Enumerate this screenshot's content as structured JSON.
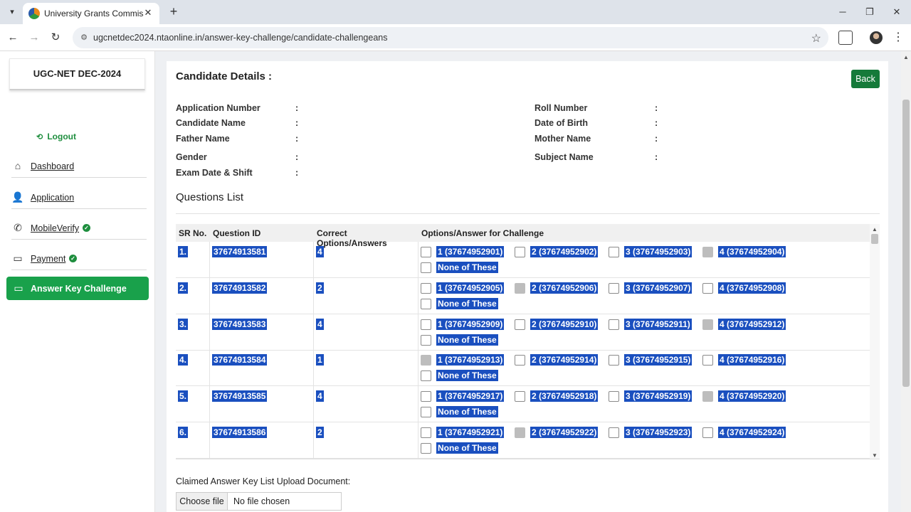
{
  "browser": {
    "tab_title": "University Grants Commission (",
    "url": "ugcnetdec2024.ntaonline.in/answer-key-challenge/candidate-challengeans"
  },
  "sidebar": {
    "brand": "UGC-NET DEC-2024",
    "logout": "Logout",
    "items": [
      {
        "label": "Dashboard",
        "icon": "home-icon",
        "verified": false
      },
      {
        "label": "Application",
        "icon": "person-add-icon",
        "verified": false
      },
      {
        "label": "MobileVerify",
        "icon": "phone-icon",
        "verified": true
      },
      {
        "label": "Payment",
        "icon": "card-icon",
        "verified": true
      }
    ],
    "active": {
      "label": "Answer Key Challenge",
      "icon": "card-icon"
    }
  },
  "candidate": {
    "title": "Candidate Details :",
    "back_label": "Back",
    "fields_left": [
      "Application Number",
      "Candidate Name",
      "Father Name",
      "Gender",
      "Exam Date & Shift"
    ],
    "fields_right": [
      "Roll Number",
      "Date of Birth",
      "Mother Name",
      "Subject Name"
    ],
    "colon": ":"
  },
  "questions": {
    "title": "Questions List",
    "headers": [
      "SR No.",
      "Question ID",
      "Correct Options/Answers",
      "Options/Answer for Challenge"
    ],
    "none_label": "None of These",
    "rows": [
      {
        "sr": "1.",
        "qid": "37674913581",
        "correct": "4",
        "options": [
          "1 (37674952901)",
          "2 (37674952902)",
          "3 (37674952903)",
          "4 (37674952904)"
        ]
      },
      {
        "sr": "2.",
        "qid": "37674913582",
        "correct": "2",
        "options": [
          "1 (37674952905)",
          "2 (37674952906)",
          "3 (37674952907)",
          "4 (37674952908)"
        ]
      },
      {
        "sr": "3.",
        "qid": "37674913583",
        "correct": "4",
        "options": [
          "1 (37674952909)",
          "2 (37674952910)",
          "3 (37674952911)",
          "4 (37674952912)"
        ]
      },
      {
        "sr": "4.",
        "qid": "37674913584",
        "correct": "1",
        "options": [
          "1 (37674952913)",
          "2 (37674952914)",
          "3 (37674952915)",
          "4 (37674952916)"
        ]
      },
      {
        "sr": "5.",
        "qid": "37674913585",
        "correct": "4",
        "options": [
          "1 (37674952917)",
          "2 (37674952918)",
          "3 (37674952919)",
          "4 (37674952920)"
        ]
      },
      {
        "sr": "6.",
        "qid": "37674913586",
        "correct": "2",
        "options": [
          "1 (37674952921)",
          "2 (37674952922)",
          "3 (37674952923)",
          "4 (37674952924)"
        ]
      }
    ]
  },
  "upload": {
    "label": "Claimed Answer Key List Upload Document:",
    "button": "Choose file",
    "status": "No file chosen"
  },
  "colors": {
    "accent_green": "#19a14b",
    "selection_blue": "#1a4fbf",
    "back_button": "#157a3a"
  }
}
